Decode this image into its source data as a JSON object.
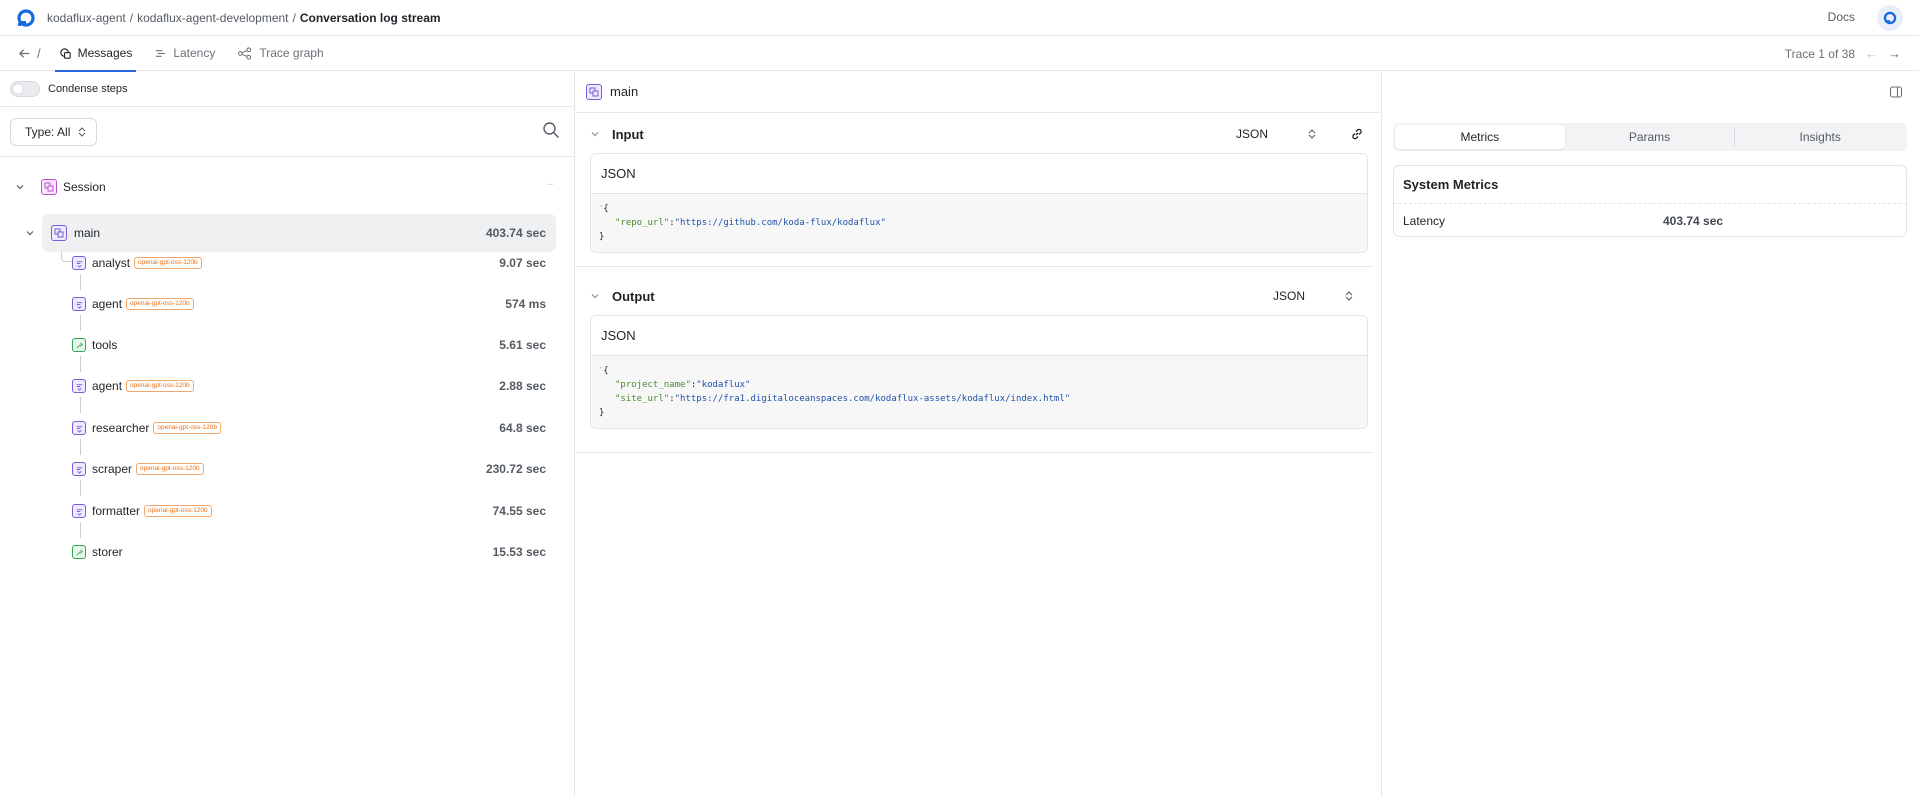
{
  "header": {
    "breadcrumb": [
      "kodaflux-agent",
      "kodaflux-agent-development",
      "Conversation log stream"
    ],
    "separator": "/",
    "docs_label": "Docs"
  },
  "tabs_row": {
    "back_sep": "/",
    "tabs": [
      {
        "label": "Messages",
        "icon": "messages-icon",
        "active": true
      },
      {
        "label": "Latency",
        "icon": "latency-icon",
        "active": false
      },
      {
        "label": "Trace graph",
        "icon": "trace-graph-icon",
        "active": false
      }
    ],
    "trace_counter": "Trace 1 of 38"
  },
  "left_panel": {
    "condense_label": "Condense steps",
    "condense_on": false,
    "type_filter": "Type: All",
    "session": {
      "label": "Session"
    },
    "main": {
      "label": "main",
      "time": "403.74 sec"
    },
    "children": [
      {
        "name": "analyst",
        "badge": "openai-gpt-oss-120b",
        "time": "9.07 sec",
        "kind": "llm"
      },
      {
        "name": "agent",
        "badge": "openai-gpt-oss-120b",
        "time": "574 ms",
        "kind": "llm"
      },
      {
        "name": "tools",
        "badge": "",
        "time": "5.61 sec",
        "kind": "tool"
      },
      {
        "name": "agent",
        "badge": "openai-gpt-oss-120b",
        "time": "2.88 sec",
        "kind": "llm"
      },
      {
        "name": "researcher",
        "badge": "openai-gpt-oss-120b",
        "time": "64.8 sec",
        "kind": "llm"
      },
      {
        "name": "scraper",
        "badge": "openai-gpt-oss-120b",
        "time": "230.72 sec",
        "kind": "llm"
      },
      {
        "name": "formatter",
        "badge": "openai-gpt-oss-120b",
        "time": "74.55 sec",
        "kind": "llm"
      },
      {
        "name": "storer",
        "badge": "",
        "time": "15.53 sec",
        "kind": "tool"
      }
    ]
  },
  "middle_panel": {
    "title": "main",
    "input": {
      "label": "Input",
      "format": "JSON",
      "card_title": "JSON",
      "open_brace": "{",
      "close_brace": "}",
      "fields": [
        {
          "key": "\"repo_url\"",
          "value": "\"https://github.com/koda-flux/kodaflux\""
        }
      ]
    },
    "output": {
      "label": "Output",
      "format": "JSON",
      "card_title": "JSON",
      "open_brace": "{",
      "close_brace": "}",
      "fields": [
        {
          "key": "\"project_name\"",
          "value": "\"kodaflux\""
        },
        {
          "key": "\"site_url\"",
          "value": "\"https://fra1.digitaloceanspaces.com/kodaflux-assets/kodaflux/index.html\""
        }
      ]
    }
  },
  "right_panel": {
    "tabs": [
      "Metrics",
      "Params",
      "Insights"
    ],
    "active_tab": "Metrics",
    "metrics_title": "System Metrics",
    "metrics": [
      {
        "label": "Latency",
        "value": "403.74 sec"
      }
    ]
  },
  "colors": {
    "accent": "#2a62e0",
    "badge_orange": "#e8711b",
    "llm_icon": "#7b5cd6",
    "tool_icon": "#2fa84f",
    "session_icon": "#c04ccf"
  }
}
